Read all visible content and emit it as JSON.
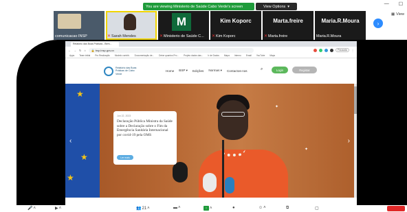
{
  "zoom": {
    "share_banner": "You are viewing Ministerio de Saúde Cabo Verde's screen",
    "view_options": "View Options",
    "view_label": "View",
    "window_controls": [
      "—",
      "☐"
    ],
    "participants": [
      {
        "name": "comunicacao INSP",
        "muted": false
      },
      {
        "name": "Sarah Mendes",
        "muted": true
      },
      {
        "name": "Ministerio de Saúde C...",
        "muted": true,
        "logo": "M"
      },
      {
        "name": "Kim Koporc",
        "muted": true,
        "big": "Kim Koporc"
      },
      {
        "name": "Marta.freire",
        "muted": true,
        "big": "Marta.freire"
      },
      {
        "name": "Maria.R.Moura",
        "muted": false,
        "big": "Maria.R.Moura"
      }
    ],
    "bottom": {
      "participants_count": "21"
    }
  },
  "browser": {
    "tab_title": "Relatório das Boas Práticas - Bem...",
    "url": "bsp.insp.gov.cv",
    "profile_label": "Pausada",
    "bookmarks": [
      "Apps",
      "Team initial",
      "Pro Realização",
      "Modelo contrib.",
      "Documentação de...",
      "Deixe quantos Pro...",
      "Projeto dados das...",
      "Ir de Dados",
      "Mapa",
      "Interno",
      "Email",
      "YouTube",
      "Maps"
    ]
  },
  "site": {
    "logo_text": "Relatório das Boas Práticas de Cabo Verde",
    "nav": [
      "Home",
      "BSP ▾",
      "Edições",
      "Normas ▾",
      "Contactos-nos"
    ],
    "login": "Login",
    "register": "Registar",
    "card": {
      "date": "Jun 22, 2023",
      "title": "Declaração Pública Ministra da Saúde sobre a Declaração sobre o Fim da Emergência Sanitária Internacional por covid-19 pela OMS",
      "button": "Ler mais"
    }
  },
  "colors": {
    "zoom_green": "#1f9b3b",
    "zoom_blue": "#2d8cff",
    "highlight": "#f1d500",
    "login_green": "#5cb85c"
  }
}
